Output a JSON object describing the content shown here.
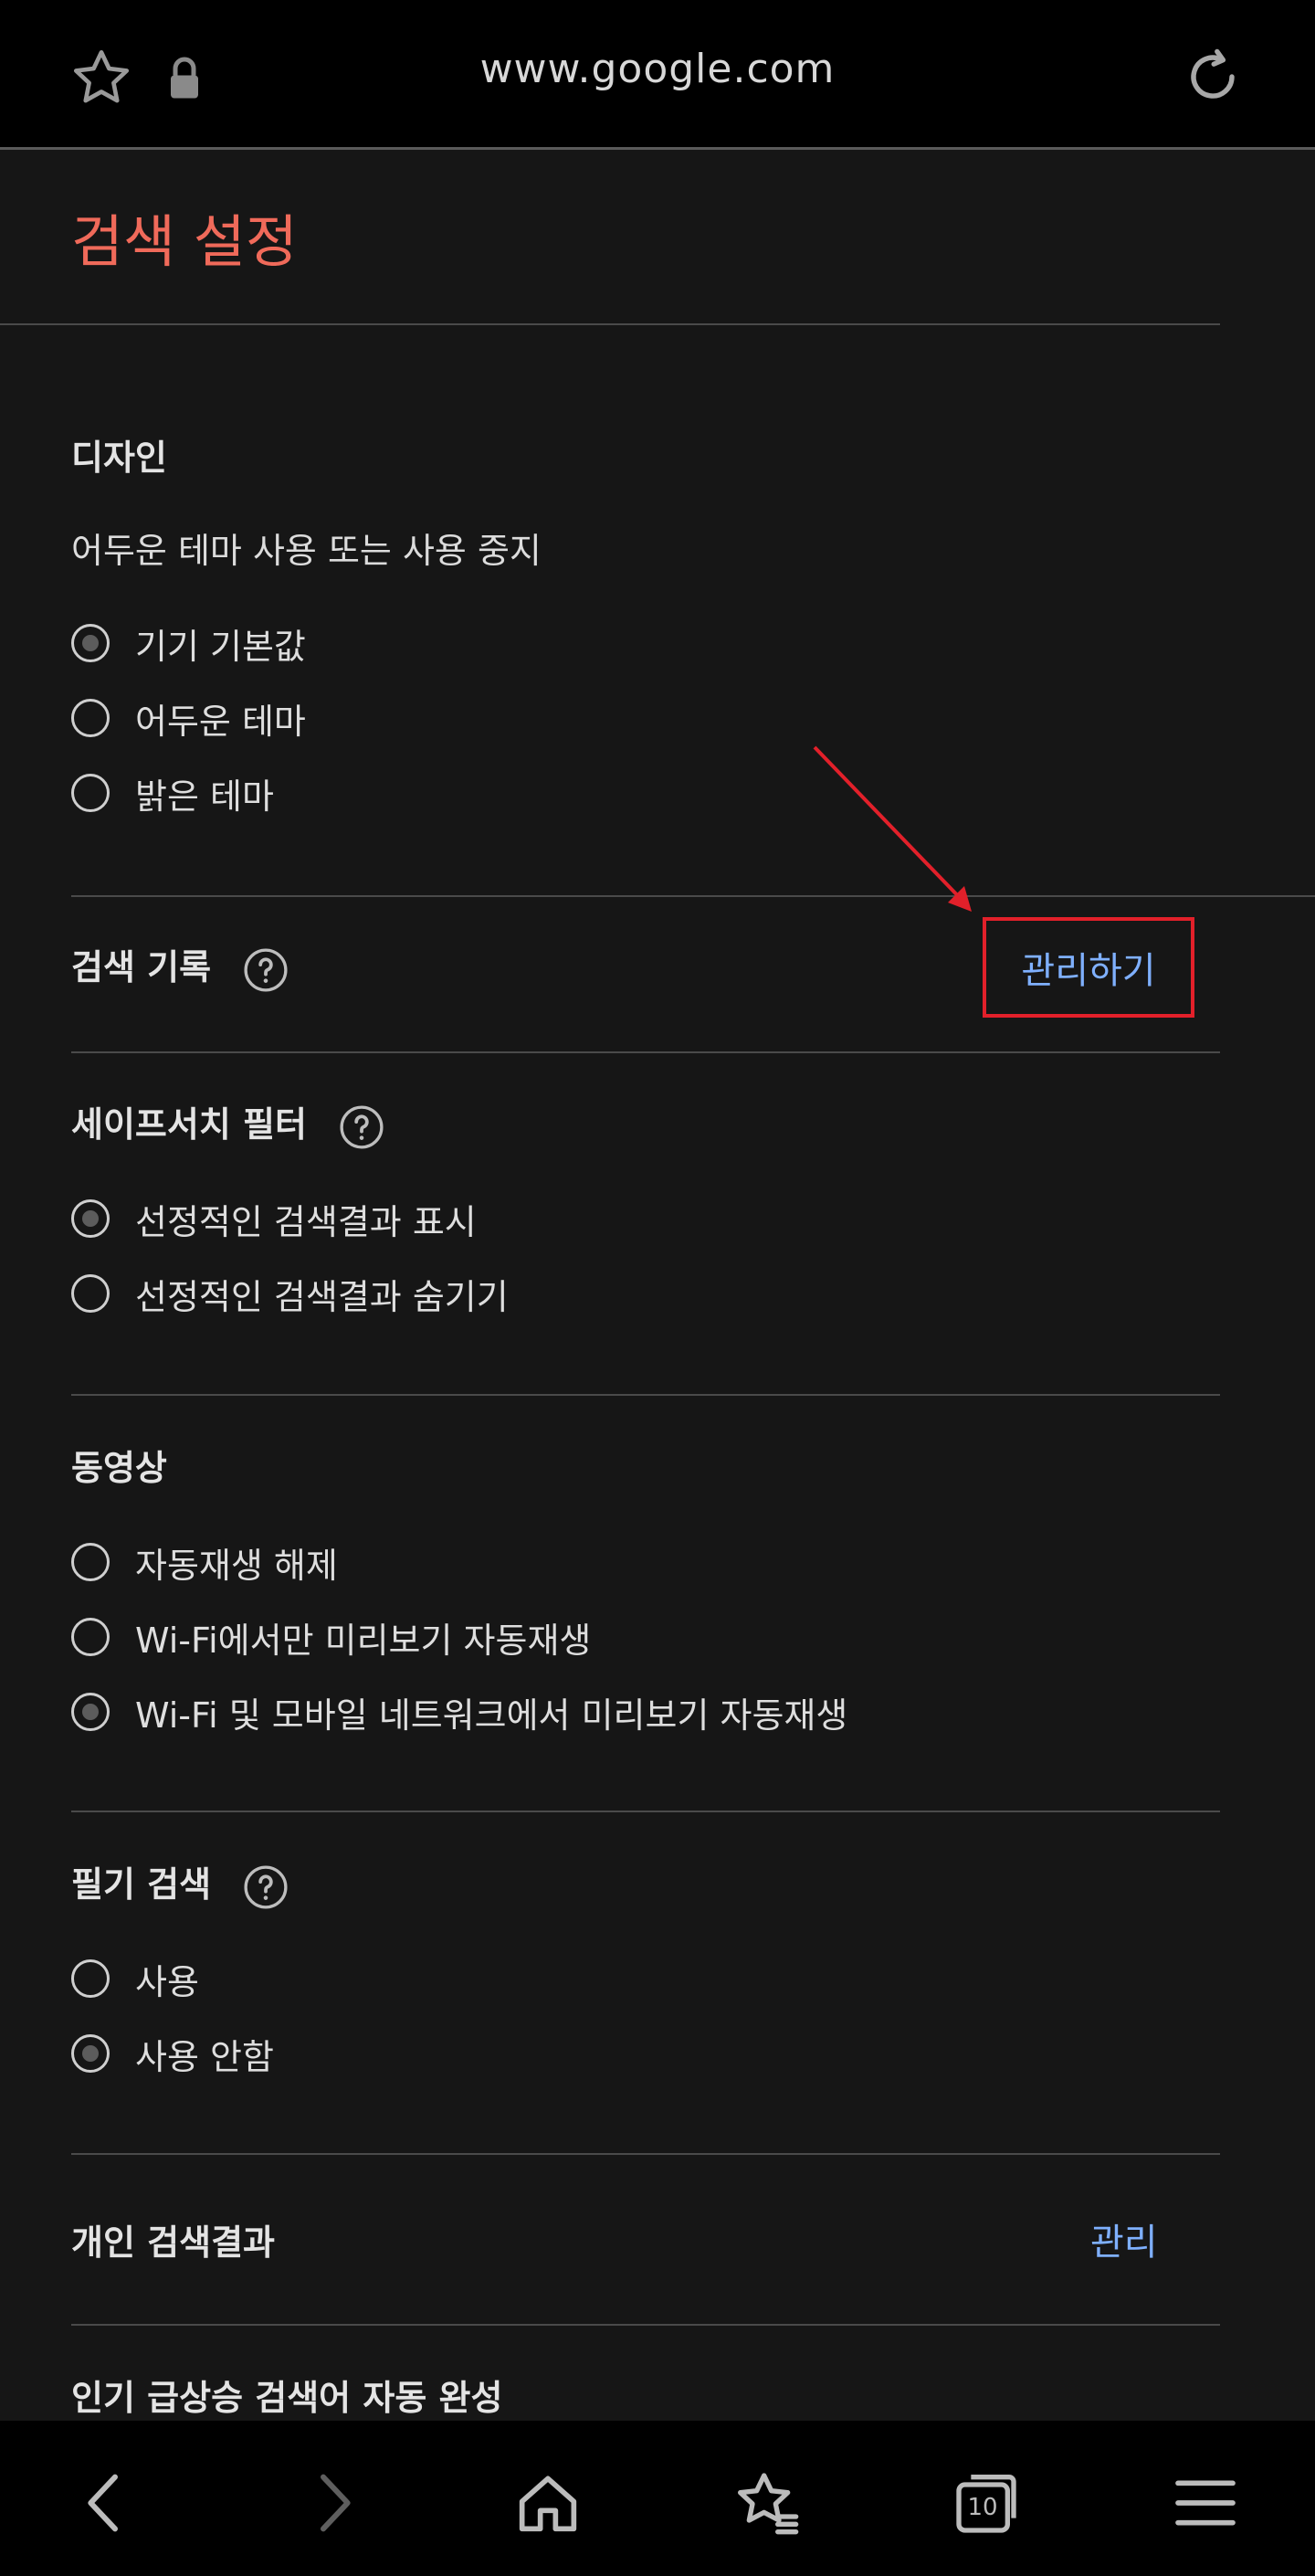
{
  "browser": {
    "url": "www.google.com",
    "icons": [
      "star-icon",
      "lock-icon",
      "reload-icon"
    ]
  },
  "page": {
    "title": "검색 설정"
  },
  "design": {
    "heading": "디자인",
    "description": "어두운 테마 사용 또는 사용 중지",
    "options": [
      {
        "label": "기기 기본값",
        "selected": true
      },
      {
        "label": "어두운 테마",
        "selected": false
      },
      {
        "label": "밝은 테마",
        "selected": false
      }
    ]
  },
  "search_history": {
    "heading": "검색 기록",
    "manage_label": "관리하기"
  },
  "safesearch": {
    "heading": "세이프서치 필터",
    "options": [
      {
        "label": "선정적인 검색결과 표시",
        "selected": true
      },
      {
        "label": "선정적인 검색결과 숨기기",
        "selected": false
      }
    ]
  },
  "video": {
    "heading": "동영상",
    "options": [
      {
        "label": "자동재생 해제",
        "selected": false
      },
      {
        "label": "Wi-Fi에서만 미리보기 자동재생",
        "selected": false
      },
      {
        "label": "Wi-Fi 및 모바일 네트워크에서 미리보기 자동재생",
        "selected": true
      }
    ]
  },
  "handwriting": {
    "heading": "필기 검색",
    "options": [
      {
        "label": "사용",
        "selected": false
      },
      {
        "label": "사용 안함",
        "selected": true
      }
    ]
  },
  "personal_results": {
    "heading": "개인 검색결과",
    "manage_label": "관리"
  },
  "trending": {
    "heading": "인기 급상승 검색어 자동 완성"
  },
  "bottom_nav": {
    "tab_count": "10",
    "icons": [
      "back-icon",
      "forward-icon",
      "home-icon",
      "bookmarks-icon",
      "tabs-icon",
      "menu-icon"
    ]
  },
  "colors": {
    "title": "#f06a5a",
    "link": "#7fb0ff",
    "highlight": "#e2202a"
  }
}
